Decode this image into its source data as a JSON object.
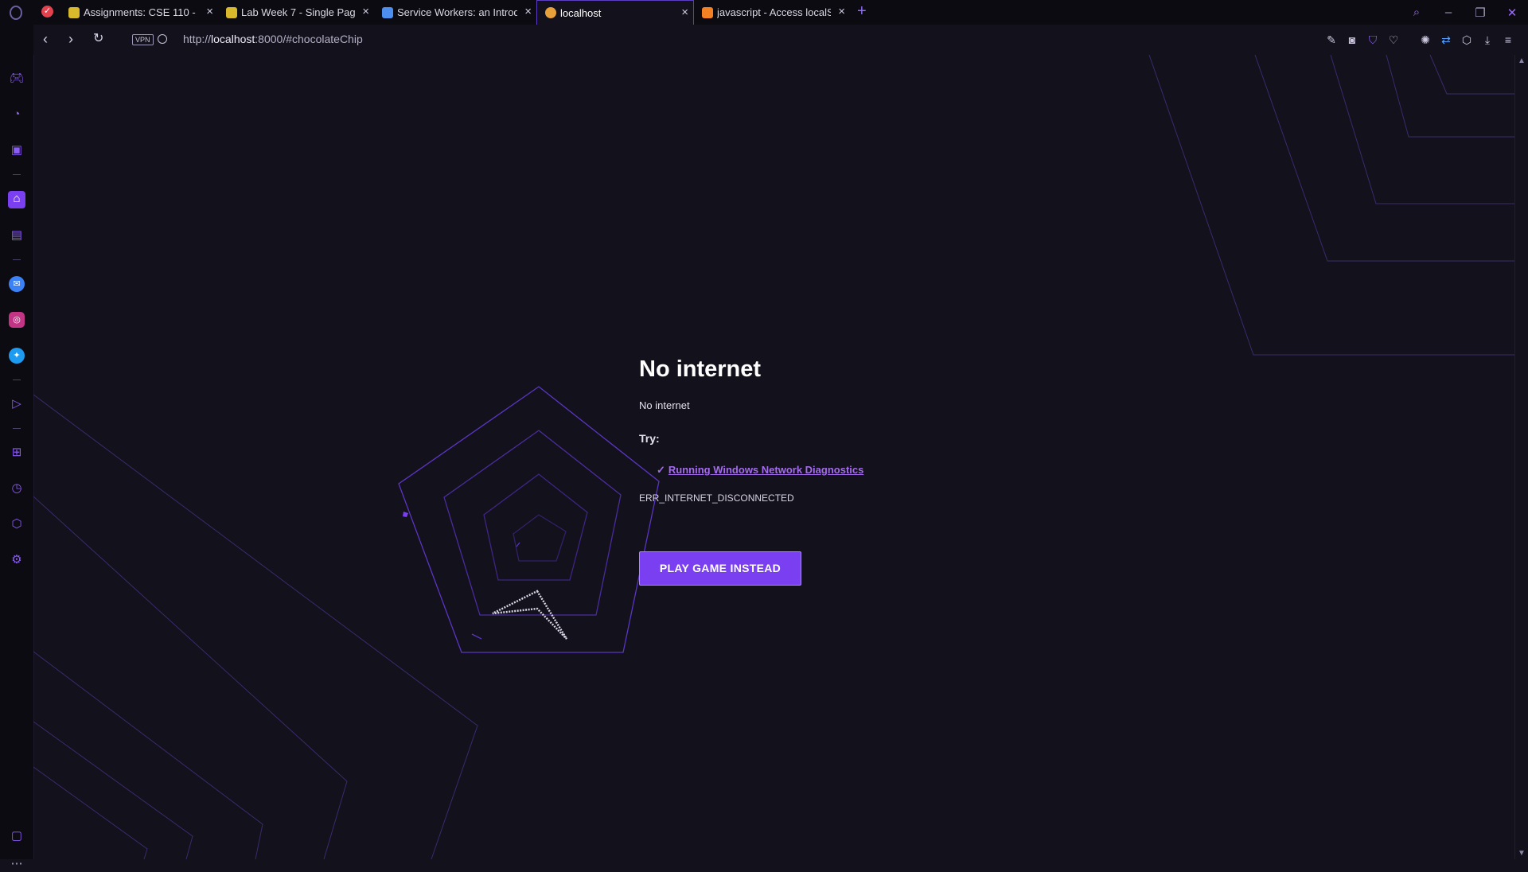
{
  "tabs": [
    {
      "label": "Assignments: CSE 110 - Sol",
      "favicon_color": "#d9b82b"
    },
    {
      "label": "Lab Week 7 - Single Page /",
      "favicon_color": "#d9b82b"
    },
    {
      "label": "Service Workers: an Introdu",
      "favicon_color": "#4d8ff0"
    },
    {
      "label": "localhost",
      "favicon_color": "#e8a13a",
      "active": true
    },
    {
      "label": "javascript - Access localSto",
      "favicon_color": "#f48024"
    }
  ],
  "address_bar": {
    "vpn_label": "VPN",
    "url_scheme": "http://",
    "url_host": "localhost",
    "url_rest": ":8000/#chocolateChip"
  },
  "error_page": {
    "title": "No internet",
    "subtitle": "No internet",
    "try_label": "Try:",
    "check_mark": "✓",
    "suggestion_link": "Running Windows Network Diagnostics",
    "error_code": "ERR_INTERNET_DISCONNECTED",
    "play_button": "PLAY GAME INSTEAD"
  },
  "colors": {
    "accent": "#7a3ff0",
    "background": "#13111b",
    "line": "#4b2f8f"
  },
  "icons": {
    "back": "chevron-left-icon",
    "forward": "chevron-right-icon",
    "reload": "reload-icon"
  }
}
